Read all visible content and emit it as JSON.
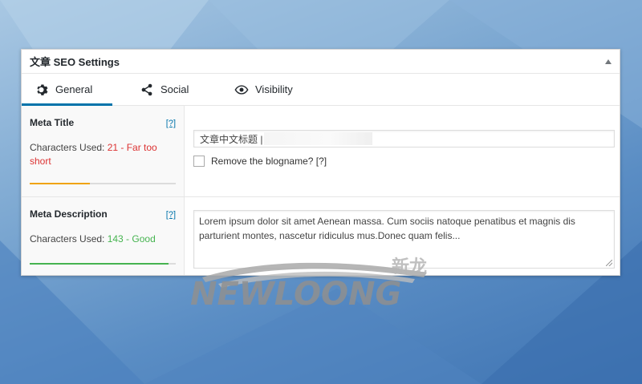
{
  "panel": {
    "title": "文章 SEO Settings"
  },
  "tabs": [
    {
      "label": "General",
      "icon": "gear-icon",
      "active": true
    },
    {
      "label": "Social",
      "icon": "share-icon",
      "active": false
    },
    {
      "label": "Visibility",
      "icon": "eye-icon",
      "active": false
    }
  ],
  "meta_title": {
    "label": "Meta Title",
    "help": "[?]",
    "chars_prefix": "Characters Used: ",
    "chars_status": "21 - Far too short",
    "meter_level": 0.41,
    "meter_color": "#f0a30a",
    "input_value": "文章中文标题 |",
    "checkbox_label": "Remove the blogname? [?]"
  },
  "meta_description": {
    "label": "Meta Description",
    "help": "[?]",
    "chars_prefix": "Characters Used: ",
    "chars_status": "143 - Good",
    "meter_level": 0.95,
    "meter_color": "#46b450",
    "textarea_value": "Lorem ipsum dolor sit amet Aenean massa. Cum sociis natoque penatibus et magnis dis parturient montes, nascetur ridiculus mus.Donec quam felis..."
  },
  "watermark": {
    "text": "NEWLOONG",
    "cn_text": "新龙"
  },
  "colors": {
    "accent": "#0073aa",
    "short": "#dc3232",
    "good": "#46b450"
  }
}
